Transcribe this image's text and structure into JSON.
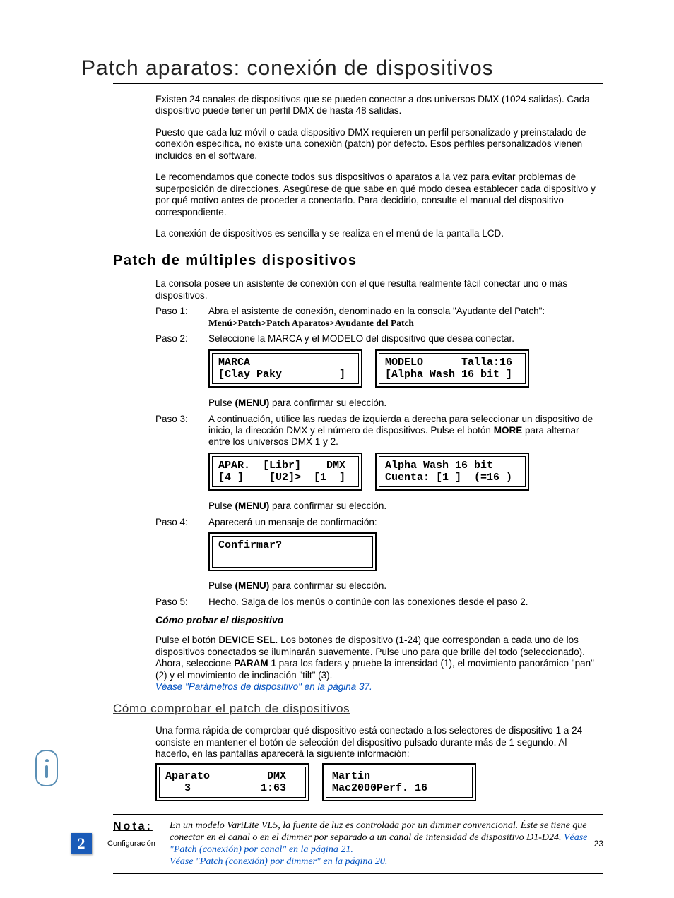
{
  "title": "Patch aparatos: conexión de dispositivos",
  "intro": {
    "p1": "Existen 24 canales de dispositivos que se pueden conectar a dos universos DMX (1024 salidas). Cada dispositivo puede tener un perfil DMX de hasta 48 salidas.",
    "p2": "Puesto que cada luz móvil o cada dispositivo DMX requieren un perfil personalizado y preinstalado de conexión específica, no existe una conexión (patch) por defecto. Esos perfiles personalizados vienen incluidos en el software.",
    "p3": "Le recomendamos que conecte todos sus dispositivos o aparatos a la vez para evitar problemas de superposición de direcciones. Asegúrese de que sabe en qué modo desea establecer cada dispositivo y por qué motivo antes de proceder a conectarlo. Para decidirlo, consulte el manual del dispositivo correspondiente.",
    "p4": "La conexión de dispositivos es sencilla y se realiza en el menú de la pantalla LCD."
  },
  "section2": {
    "heading": "Patch de múltiples dispositivos",
    "lead": "La consola posee un asistente de conexión con el que resulta realmente fácil conectar uno o más dispositivos.",
    "step1_label": "Paso 1:",
    "step1_text": "Abra el asistente de conexión, denominado en la consola \"Ayudante del Patch\":",
    "step1_path": "Menú>Patch>Patch Aparatos>Ayudante del Patch",
    "step2_label": "Paso 2:",
    "step2_text": "Seleccione la MARCA y el MODELO del dispositivo que desea conectar.",
    "lcd1a": "MARCA\n[Clay Paky         ]",
    "lcd1b": "MODELO      Talla:16\n[Alpha Wash 16 bit ]",
    "press_menu": "Pulse ",
    "press_menu_bold": "(MENU)",
    "press_menu_tail": " para confirmar su elección.",
    "step3_label": "Paso 3:",
    "step3_text_a": "A continuación, utilice las ruedas de izquierda a derecha para seleccionar un dispositivo de inicio, la dirección DMX y el número de dispositivos. Pulse el botón ",
    "step3_bold": "MORE",
    "step3_text_b": " para alternar entre los universos DMX 1 y 2.",
    "lcd2a": "APAR.  [Libr]    DMX\n[4 ]    [U2]>  [1  ]",
    "lcd2b": "Alpha Wash 16 bit\nCuenta: [1 ]  (=16 )",
    "step4_label": "Paso 4:",
    "step4_text": "Aparecerá un mensaje de confirmación:",
    "lcd3": "Confirmar?\n ",
    "step5_label": "Paso 5:",
    "step5_text": "Hecho. Salga de los menús o continúe con las conexiones desde el paso 2."
  },
  "test": {
    "heading": "Cómo probar el dispositivo",
    "p_pre": "Pulse el botón ",
    "p_bold1": "DEVICE SEL",
    "p_mid": ". Los botones de dispositivo (1-24) que correspondan a cada uno de los dispositivos conectados se iluminarán suavemente. Pulse uno para que brille del todo (seleccionado). Ahora, seleccione ",
    "p_bold2": "PARAM 1",
    "p_tail": " para los faders y pruebe la intensidad (1), el movimiento panorámico \"pan\" (2) y el movimiento de inclinación \"tilt\" (3). ",
    "p_link": "Véase \"Parámetros de dispositivo\" en la página  37."
  },
  "check": {
    "heading": "Cómo comprobar el patch de dispositivos",
    "p": "Una forma rápida de comprobar qué dispositivo está conectado a los selectores de dispositivo 1 a 24 consiste en mantener el botón de selección del dispositivo pulsado durante más de 1 segundo. Al hacerlo, en las pantallas aparecerá la siguiente información:",
    "lcd4a": "Aparato         DMX\n   3           1:63",
    "lcd4b": "Martin\nMac2000Perf. 16"
  },
  "note": {
    "label": "Nota:",
    "text_a": "En un modelo VariLite VL5, la fuente de luz es controlada por un dimmer convencional. Éste se tiene que conectar en el canal o en el dimmer por separado a un canal de intensidad de dispositivo D1-D24. ",
    "link1": "Véase \"Patch (conexión) por canal\" en la página  21.",
    "sep": " ",
    "link2": "Véase \"Patch (conexión) por dimmer\" en la página  20."
  },
  "footer": {
    "chapnum": "2",
    "chaptext": "Configuración",
    "page": "23"
  }
}
